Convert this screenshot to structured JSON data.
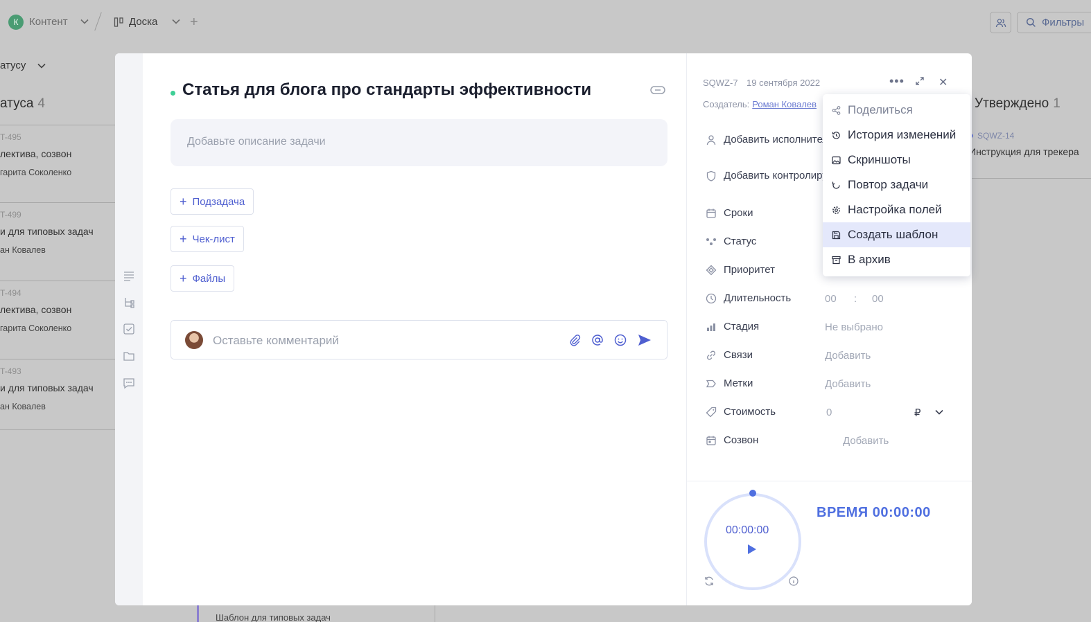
{
  "topbar": {
    "workspace_initial": "К",
    "workspace_name": "Контент",
    "board_name": "Доска",
    "add_label": "+",
    "filters_label": "Фильтры"
  },
  "background": {
    "group_selector": "атусу",
    "left_column": {
      "title": "атуса",
      "count": "4"
    },
    "right_column": {
      "title": "Утверждено",
      "count": "1"
    },
    "left_cards": [
      {
        "id": "T-495",
        "title": "лектива, созвон",
        "user": "гарита Соколенко"
      },
      {
        "id": "T-499",
        "title": "и для типовых задач",
        "user": "ан Ковалев"
      },
      {
        "id": "T-494",
        "title": "лектива, созвон",
        "user": "гарита Соколенко"
      },
      {
        "id": "T-493",
        "title": "и для типовых задач",
        "user": "ан Ковалев"
      }
    ],
    "right_card": {
      "id": "SQWZ-14",
      "title": "Инструкция для трекера"
    },
    "bottom_card_text": "Шаблон для типовых задач"
  },
  "task": {
    "title": "Статья для блога про стандарты эффективности",
    "description_placeholder": "Добавьте описание задачи",
    "buttons": {
      "subtask": "Подзадача",
      "checklist": "Чек-лист",
      "files": "Файлы"
    },
    "comment_placeholder": "Оставьте комментарий"
  },
  "sidebar": {
    "id": "SQWZ-7",
    "date": "19 сентября 2022",
    "creator_label": "Создатель:",
    "creator_name": "Роман Ковалев",
    "add_assignee": "Добавить исполнителя",
    "add_controller": "Добавить контролирующего",
    "fields": {
      "deadline": "Сроки",
      "status": "Статус",
      "priority": "Приоритет",
      "duration": "Длительность",
      "duration_hours": "00",
      "duration_sep": ":",
      "duration_minutes": "00",
      "stage": "Стадия",
      "stage_value": "Не выбрано",
      "links": "Связи",
      "links_value": "Добавить",
      "tags": "Метки",
      "tags_value": "Добавить",
      "cost": "Стоимость",
      "cost_value": "0",
      "currency": "₽",
      "call": "Созвон",
      "call_value": "Добавить"
    }
  },
  "timer": {
    "display": "00:00:00",
    "label": "ВРЕМЯ 00:00:00",
    "progress": 0
  },
  "menu": {
    "items": [
      {
        "label": "Поделиться",
        "icon": "share-icon"
      },
      {
        "label": "История изменений",
        "icon": "history-icon"
      },
      {
        "label": "Скриншоты",
        "icon": "image-icon"
      },
      {
        "label": "Повтор задачи",
        "icon": "repeat-icon"
      },
      {
        "label": "Настройка полей",
        "icon": "gear-icon"
      },
      {
        "label": "Создать шаблон",
        "icon": "save-icon"
      },
      {
        "label": "В архив",
        "icon": "archive-icon"
      }
    ],
    "highlighted": "Создать шаблон"
  },
  "colors": {
    "accent": "#4f5fd0",
    "status_dot": "#3ecf96",
    "overlay": "#c8c8c8",
    "menu_highlight": "#e4e8fb"
  }
}
